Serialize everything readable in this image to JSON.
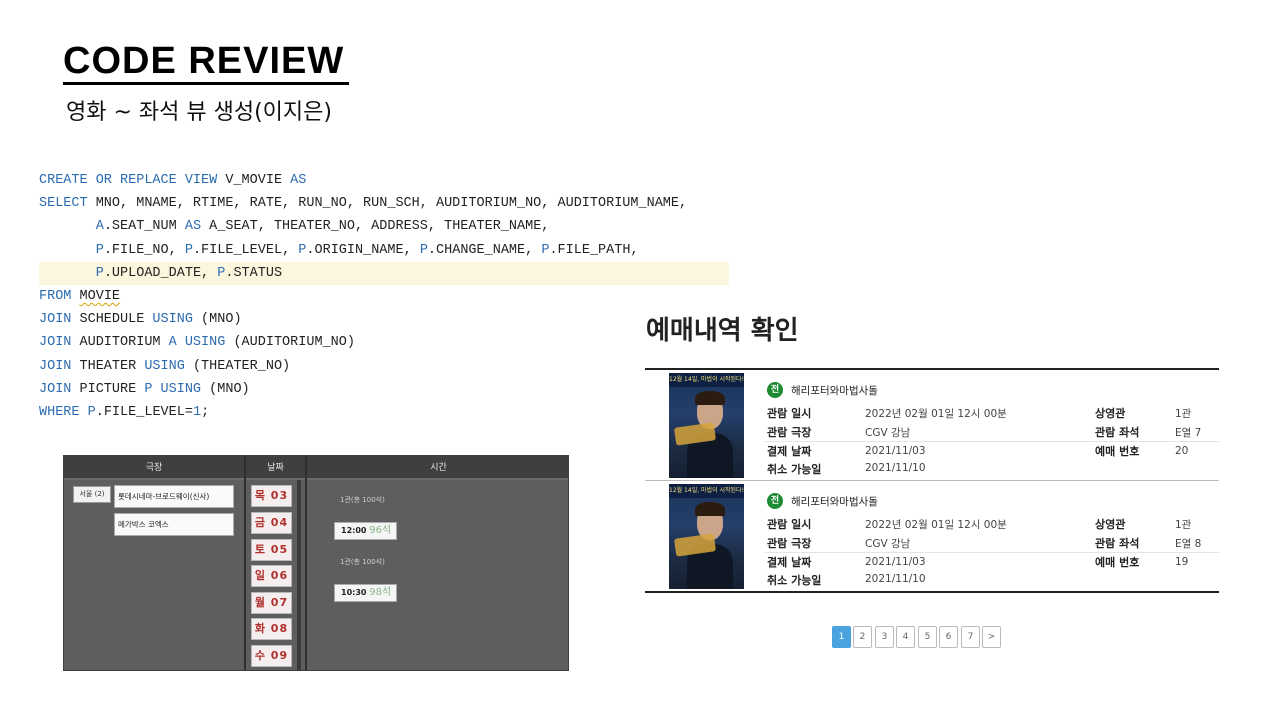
{
  "slide": {
    "title": "CODE REVIEW",
    "subtitle": "영화 ~ 좌석 뷰 생성(이지은)"
  },
  "sql": {
    "l1_kw1": "CREATE OR REPLACE VIEW",
    "l1_t1": " V_MOVIE ",
    "l1_kw2": "AS",
    "l2_kw1": "SELECT",
    "l2_t1": " MNO, MNAME, RTIME, RATE, RUN_NO, RUN_SCH, AUDITORIUM_NO, AUDITORIUM_NAME,",
    "l3_pre": "       ",
    "l3_kw1": "A",
    "l3_t1": ".SEAT_NUM ",
    "l3_kw2": "AS",
    "l3_t2": " A_SEAT, THEATER_NO, ADDRESS, THEATER_NAME,",
    "l4_pre": "       ",
    "l4_kw1": "P",
    "l4_t1": ".FILE_NO, ",
    "l4_kw2": "P",
    "l4_t2": ".FILE_LEVEL, ",
    "l4_kw3": "P",
    "l4_t3": ".ORIGIN_NAME, ",
    "l4_kw4": "P",
    "l4_t4": ".CHANGE_NAME, ",
    "l4_kw5": "P",
    "l4_t5": ".FILE_PATH,",
    "l5_pre": "       ",
    "l5_kw1": "P",
    "l5_t1": ".UPLOAD_DATE, ",
    "l5_kw2": "P",
    "l5_t2": ".STATUS",
    "l6_kw1": "FROM",
    "l6_t1": " ",
    "l6_t2": "MOVIE",
    "l7_kw1": "JOIN",
    "l7_t1": " SCHEDULE ",
    "l7_kw2": "USING",
    "l7_t2": " (MNO)",
    "l8_kw1": "JOIN",
    "l8_t1": " AUDITORIUM ",
    "l8_kw2": "A USING",
    "l8_t2": " (AUDITORIUM_NO)",
    "l9_kw1": "JOIN",
    "l9_t1": " THEATER ",
    "l9_kw2": "USING",
    "l9_t2": " (THEATER_NO)",
    "l10_kw1": "JOIN",
    "l10_t1": " PICTURE ",
    "l10_kw2": "P USING",
    "l10_t2": " (MNO)",
    "l11_kw1": "WHERE",
    "l11_t1": " ",
    "l11_kw2": "P",
    "l11_t2": ".FILE_LEVEL=",
    "l11_num": "1",
    "l11_t3": ";"
  },
  "booking": {
    "headers": {
      "theater": "극장",
      "date": "날짜",
      "time": "시간"
    },
    "region": "서울 (2)",
    "theaters": [
      "롯데시네마-브로드웨이(신사)",
      "메가박스 코엑스"
    ],
    "dates": [
      "목 03",
      "금 04",
      "토 05",
      "일 06",
      "월 07",
      "화 08",
      "수 09"
    ],
    "halls": [
      "1관(총 100석)",
      "1관(총 100석)"
    ],
    "times": [
      {
        "time": "12:00",
        "seats": "96석"
      },
      {
        "time": "10:30",
        "seats": "98석"
      }
    ]
  },
  "reservations": {
    "title": "예매내역 확인",
    "poster_banner": "12월 14일, 마법이 시작된다!",
    "labels": {
      "view_datetime": "관람 일시",
      "view_theater": "관람 극장",
      "pay_date": "결제 날짜",
      "cancel_until": "취소 가능일",
      "auditorium": "상영관",
      "seat": "관람 좌석",
      "reserve_no": "예매 번호"
    },
    "items": [
      {
        "grade": "전",
        "movie": "해리포터와마법사돌",
        "view_datetime": "2022년 02월 01일 12시 00분",
        "view_theater": "CGV 강남",
        "pay_date": "2021/11/03",
        "cancel_until": "2021/11/10",
        "auditorium": "1관",
        "seat": "E열 7",
        "reserve_no": "20"
      },
      {
        "grade": "전",
        "movie": "해리포터와마법사돌",
        "view_datetime": "2022년 02월 01일 12시 00분",
        "view_theater": "CGV 강남",
        "pay_date": "2021/11/03",
        "cancel_until": "2021/11/10",
        "auditorium": "1관",
        "seat": "E열 8",
        "reserve_no": "19"
      }
    ],
    "pagination": [
      "1",
      "2",
      "3",
      "4",
      "5",
      "6",
      "7",
      ">"
    ],
    "active_page": "1",
    "accent_color": "#4aa3df",
    "grade_color": "#1d8a34"
  }
}
